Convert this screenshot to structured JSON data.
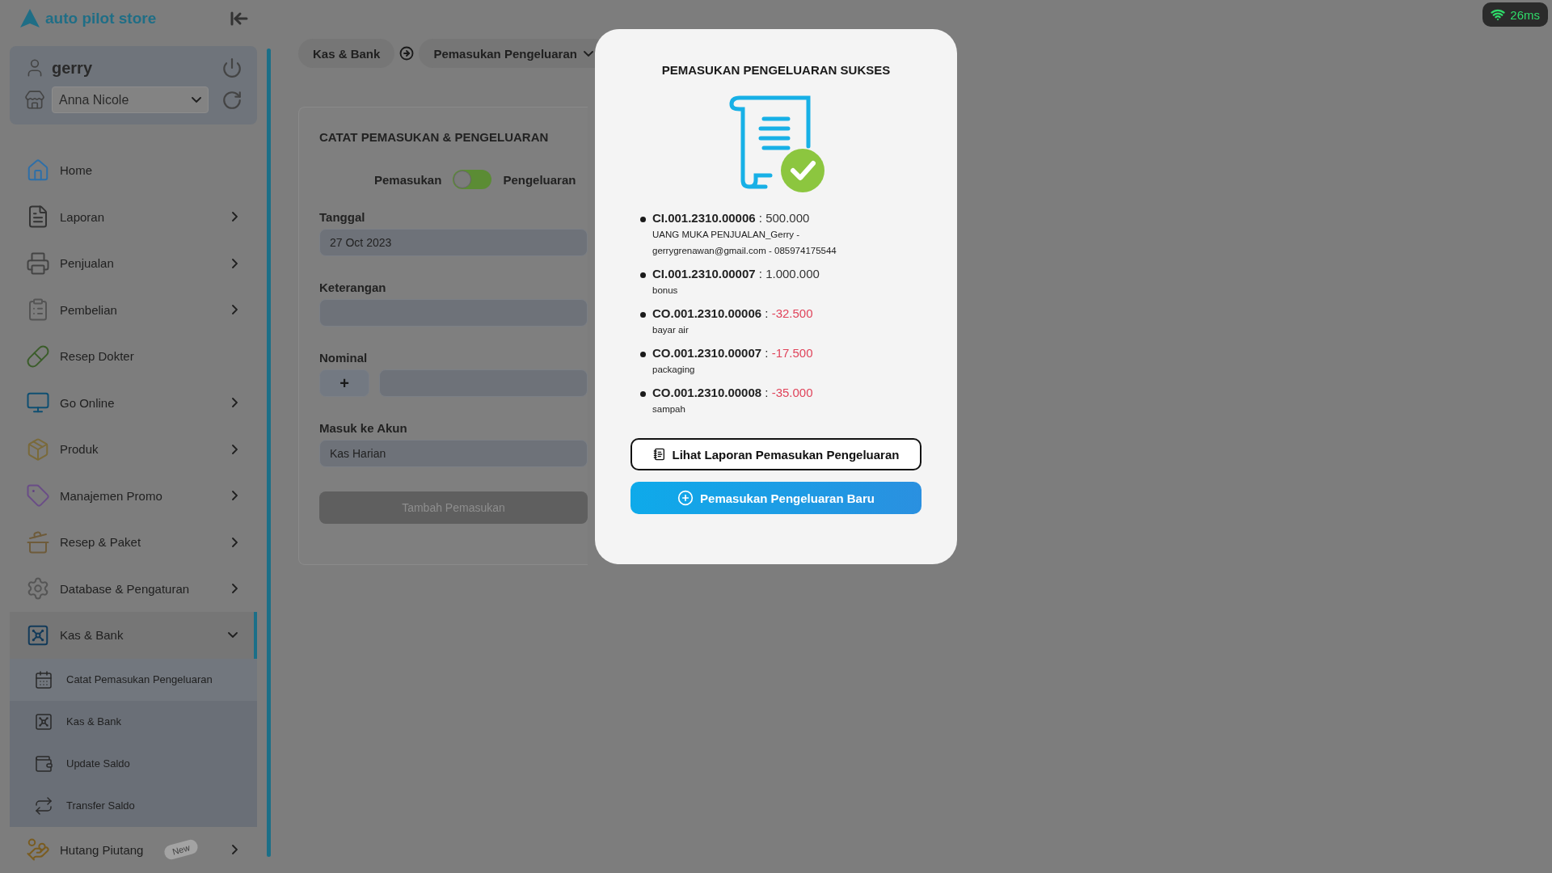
{
  "app": {
    "logo_text": "auto pilot store"
  },
  "user": {
    "name": "gerry",
    "store": "Anna Nicole"
  },
  "sidebar": {
    "items": [
      {
        "label": "Home",
        "kind": "link"
      },
      {
        "label": "Laporan",
        "kind": "group",
        "expanded": false
      },
      {
        "label": "Penjualan",
        "kind": "group",
        "expanded": false
      },
      {
        "label": "Pembelian",
        "kind": "group",
        "expanded": false
      },
      {
        "label": "Resep Dokter",
        "kind": "link"
      },
      {
        "label": "Go Online",
        "kind": "group",
        "expanded": false
      },
      {
        "label": "Produk",
        "kind": "group",
        "expanded": false
      },
      {
        "label": "Manajemen Promo",
        "kind": "group",
        "expanded": false
      },
      {
        "label": "Resep & Paket",
        "kind": "group",
        "expanded": false
      },
      {
        "label": "Database & Pengaturan",
        "kind": "group",
        "expanded": false
      },
      {
        "label": "Kas & Bank",
        "kind": "group",
        "expanded": true,
        "children": [
          {
            "label": "Catat Pemasukan Pengeluaran",
            "selected": true
          },
          {
            "label": "Kas & Bank",
            "selected": false
          },
          {
            "label": "Update Saldo",
            "selected": false
          },
          {
            "label": "Transfer Saldo",
            "selected": false
          }
        ]
      },
      {
        "label": "Hutang Piutang",
        "kind": "group",
        "expanded": false,
        "badge": "New"
      }
    ]
  },
  "breadcrumb": [
    "Kas & Bank",
    "Pemasukan Pengeluaran"
  ],
  "form": {
    "title": "CATAT PEMASUKAN & PENGELUARAN",
    "toggle": {
      "left": "Pemasukan",
      "right": "Pengeluaran",
      "on": false
    },
    "fields": [
      {
        "label": "Tanggal",
        "kind": "text",
        "value": "27 Oct 2023"
      },
      {
        "label": "Keterangan",
        "kind": "text"
      },
      {
        "label": "Nominal",
        "kind": "amount",
        "sign": "+"
      },
      {
        "label": "Masuk ke Akun",
        "kind": "text",
        "value": "Kas Harian"
      }
    ],
    "submit": {
      "label": "Tambah Pemasukan",
      "disabled": true
    }
  },
  "modal": {
    "title": "PEMASUKAN PENGELUARAN SUKSES",
    "entries": [
      {
        "code": "CI.001.2310.00006",
        "separator": ":",
        "amount": "500.000",
        "negative": false,
        "note": "UANG MUKA PENJUALAN_Gerry - gerrygrenawan@gmail.com - 085974175544"
      },
      {
        "code": "CI.001.2310.00007",
        "separator": ":",
        "amount": "1.000.000",
        "negative": false,
        "note": "bonus"
      },
      {
        "code": "CO.001.2310.00006",
        "separator": ":",
        "amount": "-32.500",
        "negative": true,
        "note": "bayar air"
      },
      {
        "code": "CO.001.2310.00007",
        "separator": ":",
        "amount": "-17.500",
        "negative": true,
        "note": "packaging"
      },
      {
        "code": "CO.001.2310.00008",
        "separator": ":",
        "amount": "-35.000",
        "negative": true,
        "note": "sampah"
      }
    ],
    "buttons": [
      {
        "label": "Lihat Laporan Pemasukan Pengeluaran",
        "kind": "outline"
      },
      {
        "label": "Pemasukan Pengeluaran Baru",
        "kind": "primary"
      }
    ]
  },
  "status": {
    "latency": "26ms"
  }
}
